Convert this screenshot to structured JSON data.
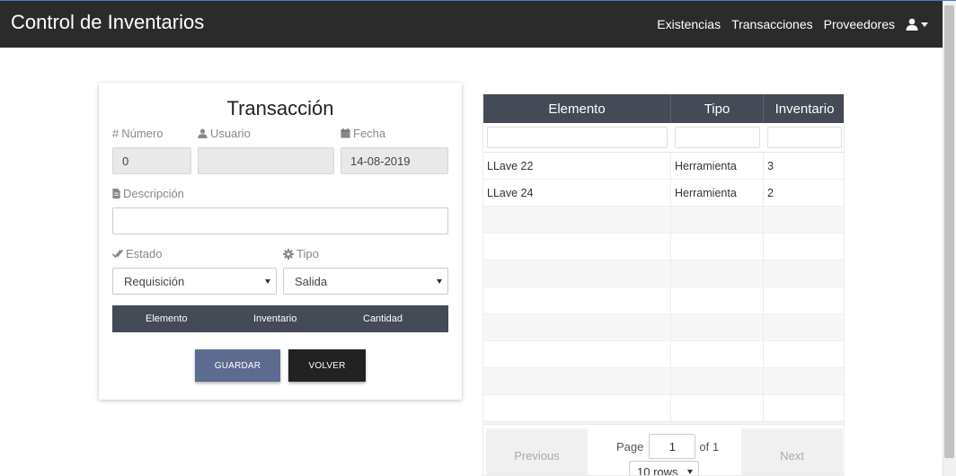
{
  "app": {
    "title": "Control de Inventarios",
    "nav": [
      "Existencias",
      "Transacciones",
      "Proveedores"
    ],
    "user_icon": "user-icon"
  },
  "form": {
    "title": "Transacción",
    "numero": {
      "label": "Número",
      "value": "0"
    },
    "usuario": {
      "label": "Usuario",
      "value": ""
    },
    "fecha": {
      "label": "Fecha",
      "value": "14-08-2019"
    },
    "descripcion": {
      "label": "Descripción",
      "value": ""
    },
    "estado": {
      "label": "Estado",
      "value": "Requisición"
    },
    "tipo": {
      "label": "Tipo",
      "value": "Salida"
    },
    "items_columns": [
      "Elemento",
      "Inventario",
      "Cantidad"
    ],
    "save_label": "GUARDAR",
    "back_label": "VOLVER"
  },
  "table": {
    "columns": [
      "Elemento",
      "Tipo",
      "Inventario"
    ],
    "rows": [
      [
        "LLave 22",
        "Herramienta",
        "3"
      ],
      [
        "LLave 24",
        "Herramienta",
        "2"
      ]
    ],
    "pagination": {
      "previous": "Previous",
      "next": "Next",
      "page_label": "Page",
      "page": "1",
      "of_label": "of 1",
      "rows_label": "10 rows"
    }
  },
  "colors": {
    "navbar": "#2b2b2b",
    "header": "#444a56",
    "save_button": "#5c6b8f",
    "back_button": "#222222"
  }
}
